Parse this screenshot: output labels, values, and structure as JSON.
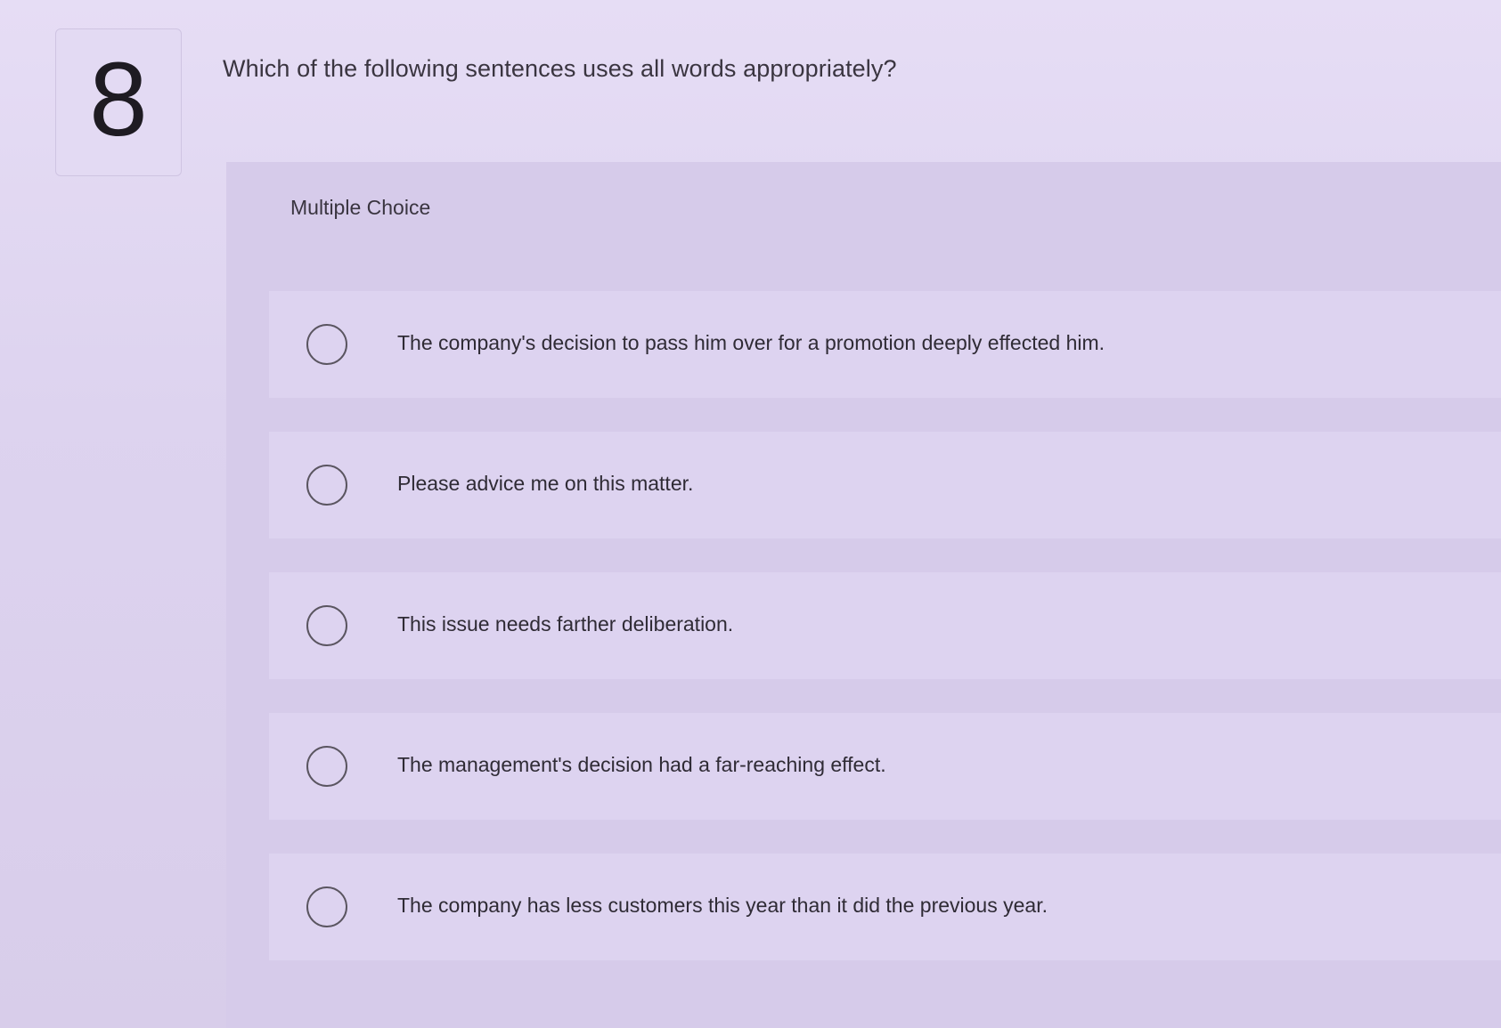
{
  "question": {
    "number": "8",
    "text": "Which of the following sentences uses all words appropriately?"
  },
  "answer_section": {
    "type_label": "Multiple Choice",
    "options": [
      {
        "label": "The company's decision to pass him over for a promotion deeply effected him.",
        "selected": false
      },
      {
        "label": "Please advice me on this matter.",
        "selected": false
      },
      {
        "label": "This issue needs farther deliberation.",
        "selected": false
      },
      {
        "label": "The management's decision had a far-reaching effect.",
        "selected": false
      },
      {
        "label": "The company has less customers this year than it did the previous year.",
        "selected": false
      }
    ]
  }
}
